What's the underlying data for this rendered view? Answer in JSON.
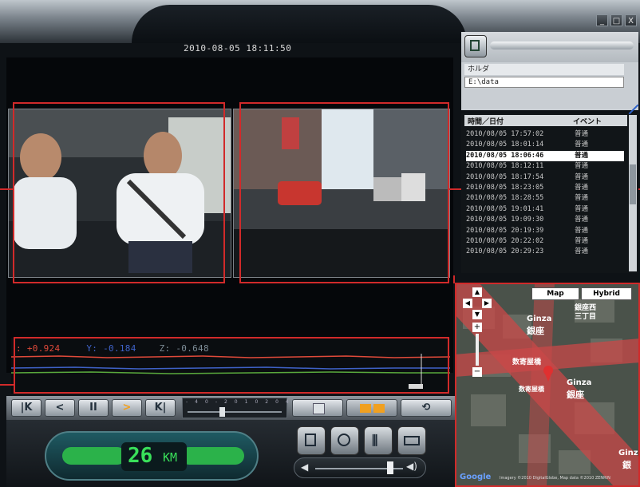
{
  "window": {
    "minimize_label": "_",
    "maximize_label": "□",
    "close_label": "X"
  },
  "video": {
    "timestamp": "2010-08-05 18:11:50"
  },
  "graph": {
    "x_readout": ": +0.924",
    "y_readout": "Y: -0.184",
    "z_readout": "Z: -0.648",
    "colors": {
      "x": "#e04a3a",
      "y": "#3f62c8",
      "z": "#59a83c"
    }
  },
  "controls": {
    "first_label": "K",
    "prev_label": "<",
    "pause_label": "II",
    "play_label": ">",
    "last_label": "K",
    "scale_ticks": [
      "-40",
      "-20",
      "10",
      "20",
      "40",
      "70"
    ],
    "speed_value": "26",
    "speed_unit": "KM",
    "accent": "#f0a020"
  },
  "folder": {
    "label": "ホルダ",
    "path": "E:\\data"
  },
  "event_list": {
    "col_time": "時間／日付",
    "col_event": "イベント",
    "rows": [
      {
        "time": "2010/08/05 17:57:02",
        "event": "普通"
      },
      {
        "time": "2010/08/05 18:01:14",
        "event": "普通"
      },
      {
        "time": "2010/08/05 18:06:46",
        "event": "普通"
      },
      {
        "time": "2010/08/05 18:12:11",
        "event": "普通"
      },
      {
        "time": "2010/08/05 18:17:54",
        "event": "普通"
      },
      {
        "time": "2010/08/05 18:23:05",
        "event": "普通"
      },
      {
        "time": "2010/08/05 18:28:55",
        "event": "普通"
      },
      {
        "time": "2010/08/05 19:01:41",
        "event": "普通"
      },
      {
        "time": "2010/08/05 19:09:30",
        "event": "普通"
      },
      {
        "time": "2010/08/05 20:19:39",
        "event": "普通"
      },
      {
        "time": "2010/08/05 20:22:02",
        "event": "普通"
      },
      {
        "time": "2010/08/05 20:29:23",
        "event": "普通"
      }
    ],
    "selected_index": 2
  },
  "map": {
    "map_button": "Map",
    "hybrid_button": "Hybrid",
    "label_ginza_1": "Ginza",
    "label_ginza_1_jp": "銀座",
    "label_ginza_2": "Ginza",
    "label_ginza_2_jp": "銀座",
    "label_ginza_3": "銀座西",
    "label_ginza_3b": "三丁目",
    "label_sukiyabashi": "数寄屋橋",
    "label_sukiyabashi_2": "数寄屋橋",
    "label_bottom_right": "Ginz",
    "label_bottom_right_2": "銀",
    "google_logo": "Google",
    "copyright": "Imagery ©2010 DigitalGlobe, Map data ©2010 ZENRIN"
  }
}
